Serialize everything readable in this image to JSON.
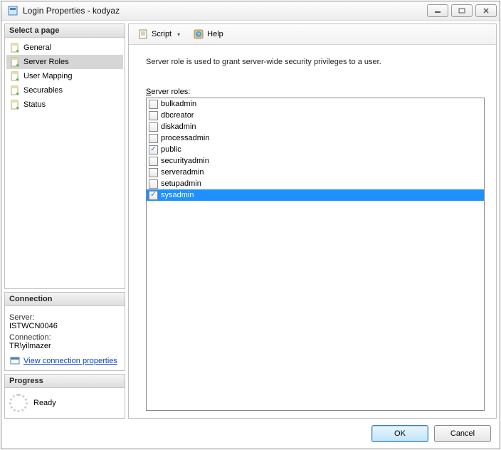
{
  "window": {
    "title": "Login Properties - kodyaz"
  },
  "sidebar": {
    "header": "Select a page",
    "items": [
      {
        "label": "General"
      },
      {
        "label": "Server Roles",
        "selected": true
      },
      {
        "label": "User Mapping"
      },
      {
        "label": "Securables"
      },
      {
        "label": "Status"
      }
    ]
  },
  "connection": {
    "header": "Connection",
    "server_label": "Server:",
    "server_value": "ISTWCN0046",
    "conn_label": "Connection:",
    "conn_value": "TR\\yilmazer",
    "link": "View connection properties"
  },
  "progress": {
    "header": "Progress",
    "status": "Ready"
  },
  "toolbar": {
    "script": "Script",
    "help": "Help"
  },
  "main": {
    "description": "Server role is used to grant server-wide security privileges to a user.",
    "list_label_u": "S",
    "list_label_rest": "erver roles:",
    "roles": [
      {
        "name": "bulkadmin",
        "checked": false
      },
      {
        "name": "dbcreator",
        "checked": false
      },
      {
        "name": "diskadmin",
        "checked": false
      },
      {
        "name": "processadmin",
        "checked": false
      },
      {
        "name": "public",
        "checked": true
      },
      {
        "name": "securityadmin",
        "checked": false
      },
      {
        "name": "serveradmin",
        "checked": false
      },
      {
        "name": "setupadmin",
        "checked": false
      },
      {
        "name": "sysadmin",
        "checked": true,
        "selected": true
      }
    ]
  },
  "buttons": {
    "ok": "OK",
    "cancel": "Cancel"
  }
}
